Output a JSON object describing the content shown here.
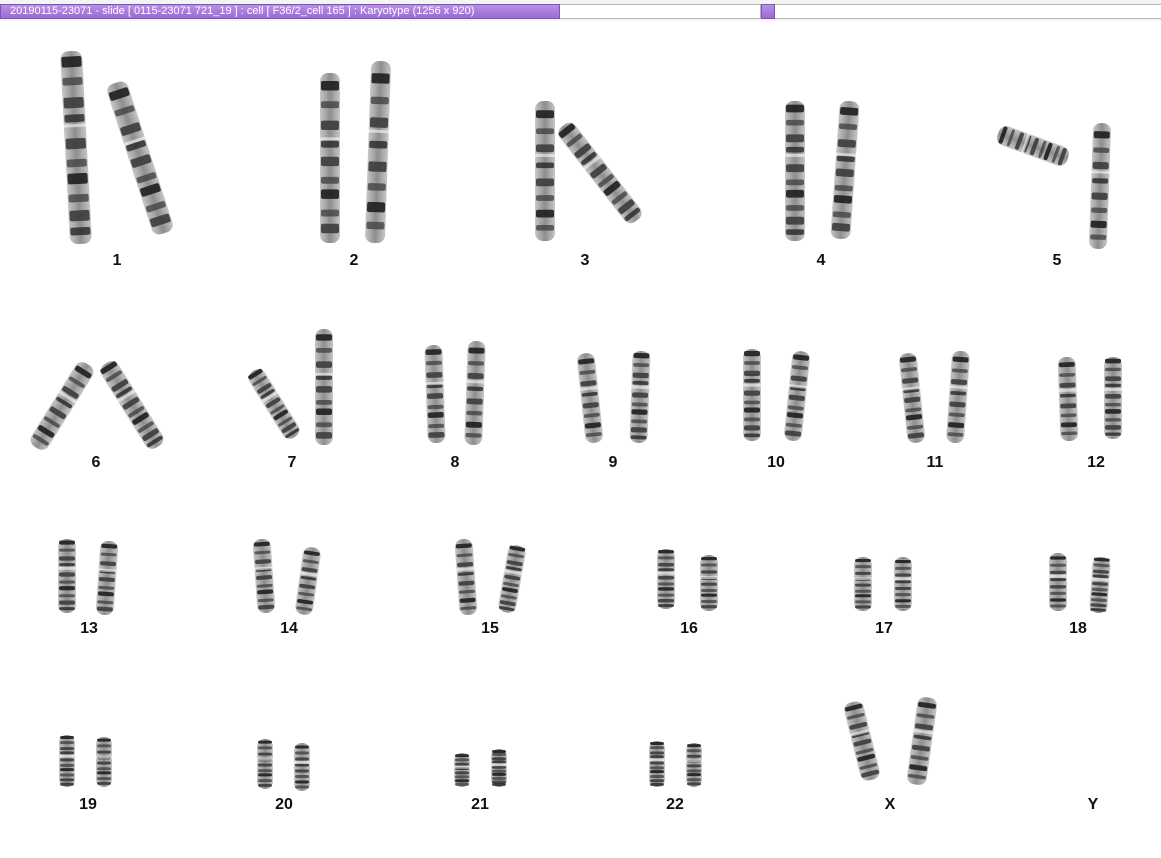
{
  "window": {
    "title": "20190115-23071 - slide [ 0115-23071 721_19 ] : cell [ F36/2_cell 165 ] : Karyotype  (1256 x 920)"
  },
  "karyotype": {
    "chromosomes": [
      {
        "label": "1"
      },
      {
        "label": "2"
      },
      {
        "label": "3"
      },
      {
        "label": "4"
      },
      {
        "label": "5"
      },
      {
        "label": "6"
      },
      {
        "label": "7"
      },
      {
        "label": "8"
      },
      {
        "label": "9"
      },
      {
        "label": "10"
      },
      {
        "label": "11"
      },
      {
        "label": "12"
      },
      {
        "label": "13"
      },
      {
        "label": "14"
      },
      {
        "label": "15"
      },
      {
        "label": "16"
      },
      {
        "label": "17"
      },
      {
        "label": "18"
      },
      {
        "label": "19"
      },
      {
        "label": "20"
      },
      {
        "label": "21"
      },
      {
        "label": "22"
      },
      {
        "label": "X"
      },
      {
        "label": "Y"
      }
    ]
  }
}
